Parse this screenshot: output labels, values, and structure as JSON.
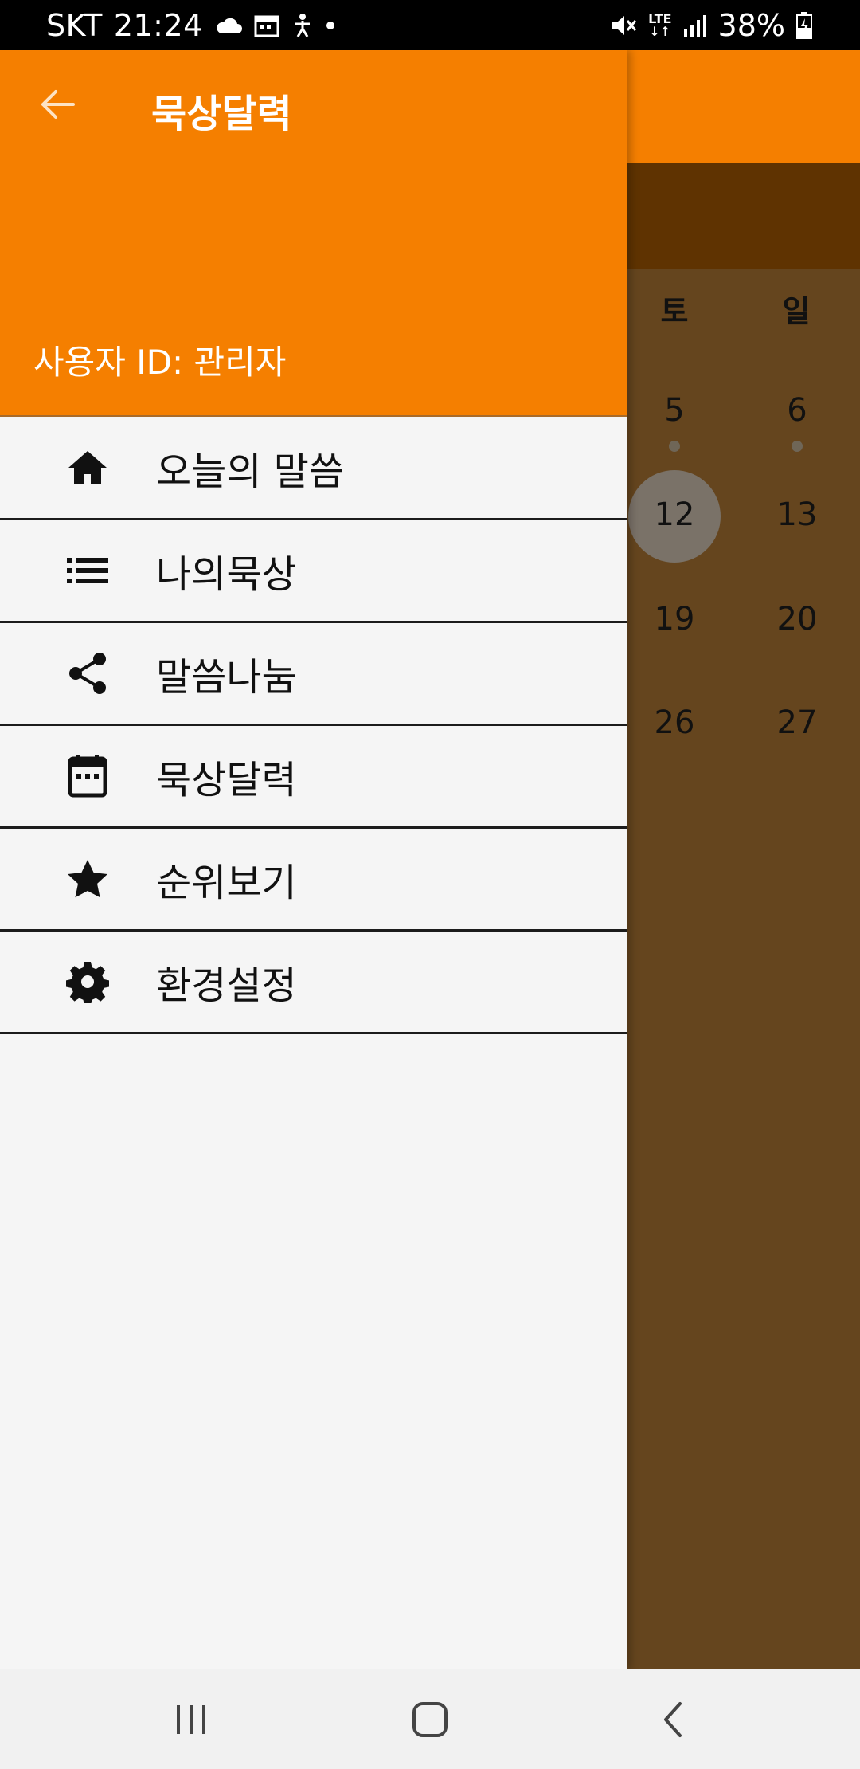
{
  "status_bar": {
    "carrier": "SKT",
    "time": "21:24",
    "network": "LTE",
    "battery": "38%",
    "icons": [
      "cloud-icon",
      "calendar-icon",
      "accessibility-icon",
      "dot-icon",
      "mute-icon",
      "lte-icon",
      "signal-icon",
      "battery-charging-icon"
    ]
  },
  "header": {
    "title": "묵상달력",
    "user_id": "사용자 ID: 관리자"
  },
  "menu": [
    {
      "label": "오늘의 말씀",
      "icon": "home-icon"
    },
    {
      "label": "나의묵상",
      "icon": "list-icon"
    },
    {
      "label": "말씀나눔",
      "icon": "share-icon"
    },
    {
      "label": "묵상달력",
      "icon": "calendar-icon"
    },
    {
      "label": "순위보기",
      "icon": "star-icon"
    },
    {
      "label": "환경설정",
      "icon": "gear-icon"
    }
  ],
  "calendar": {
    "headers": [
      "토",
      "일"
    ],
    "weeks": [
      [
        "5",
        "6"
      ],
      [
        "12",
        "13"
      ],
      [
        "19",
        "20"
      ],
      [
        "26",
        "27"
      ]
    ],
    "selected_day": "12"
  },
  "colors": {
    "accent": "#f57f00",
    "drawer_bg": "#f5f5f5",
    "scrim_calendar": "#65451e"
  },
  "nav_bar": {
    "buttons": [
      "recent-apps-icon",
      "home-button-icon",
      "back-chevron-icon"
    ]
  }
}
